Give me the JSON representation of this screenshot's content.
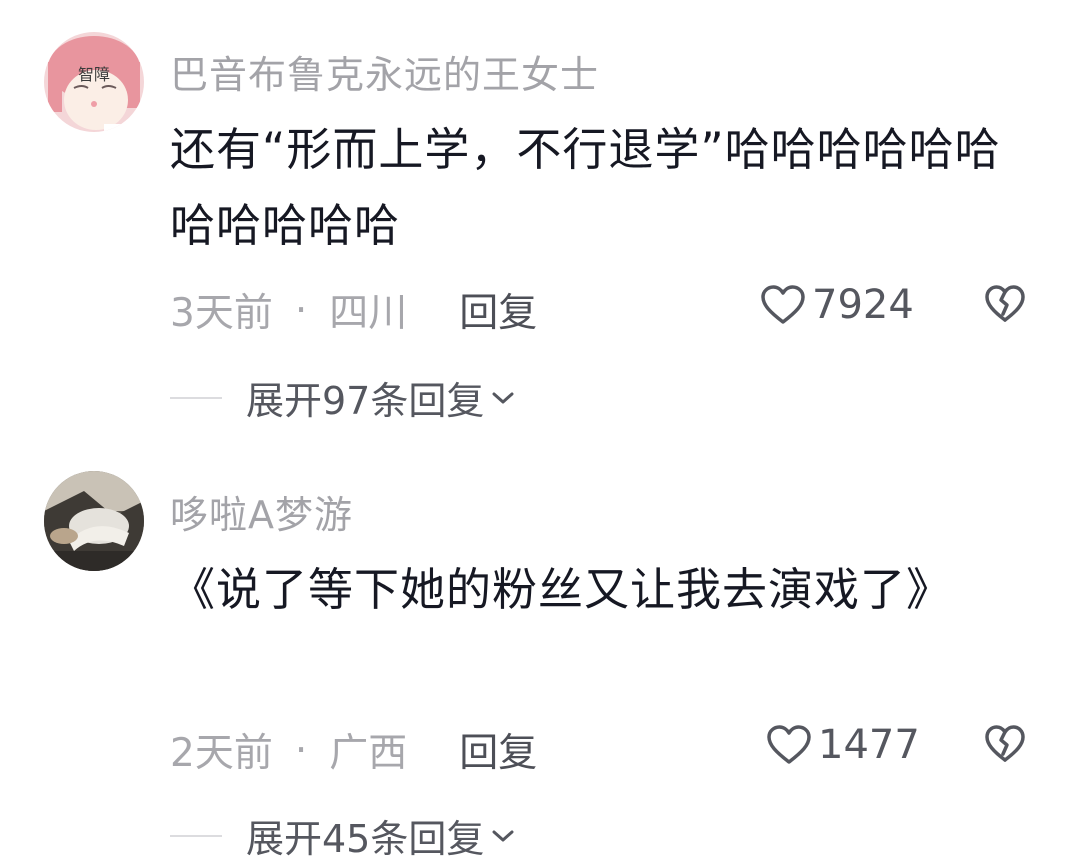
{
  "comments": [
    {
      "username": "巴音布鲁克永远的王女士",
      "avatar_text": "智障",
      "content": "还有“形而上学，不行退学”哈哈哈哈哈哈哈哈哈哈哈",
      "time": "3天前",
      "separator": "·",
      "location": "四川",
      "reply_label": "回复",
      "likes": "7924",
      "expand_label": "展开97条回复"
    },
    {
      "username": "哆啦A梦游",
      "content": "《说了等下她的粉丝又让我去演戏了》",
      "time": "2天前",
      "separator": "·",
      "location": "广西",
      "reply_label": "回复",
      "likes": "1477",
      "expand_label": "展开45条回复"
    }
  ],
  "colors": {
    "username": "#a3a3a8",
    "content": "#161823",
    "meta": "#a7a7ac",
    "action": "#55575f"
  },
  "icons": [
    "heart-icon",
    "broken-heart-icon",
    "chevron-down-icon"
  ]
}
